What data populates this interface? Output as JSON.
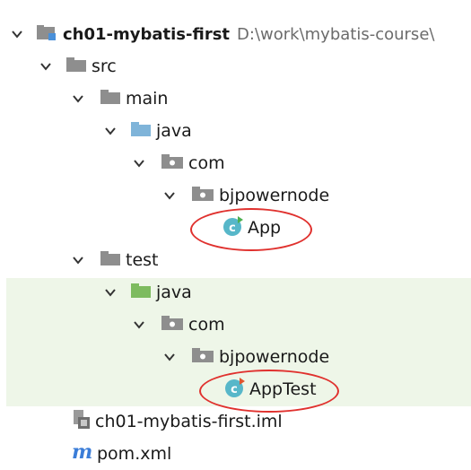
{
  "tree": {
    "project": {
      "name": "ch01-mybatis-first",
      "path": "D:\\work\\mybatis-course\\"
    },
    "src": "src",
    "main": "main",
    "main_java": "java",
    "main_com": "com",
    "main_pkg": "bjpowernode",
    "app_class": "App",
    "test": "test",
    "test_java": "java",
    "test_com": "com",
    "test_pkg": "bjpowernode",
    "apptest_class": "AppTest",
    "iml_file": "ch01-mybatis-first.iml",
    "pom_file": "pom.xml"
  },
  "colors": {
    "folder_gray": "#8e8e8e",
    "source_root_blue": "#7fb4d9",
    "test_root_green": "#7dbb5f",
    "class_icon_cyan": "#57b7c9",
    "highlight_circle": "#e0312e",
    "test_area_bg": "#eef6e8",
    "maven_m": "#3b7dd8"
  }
}
